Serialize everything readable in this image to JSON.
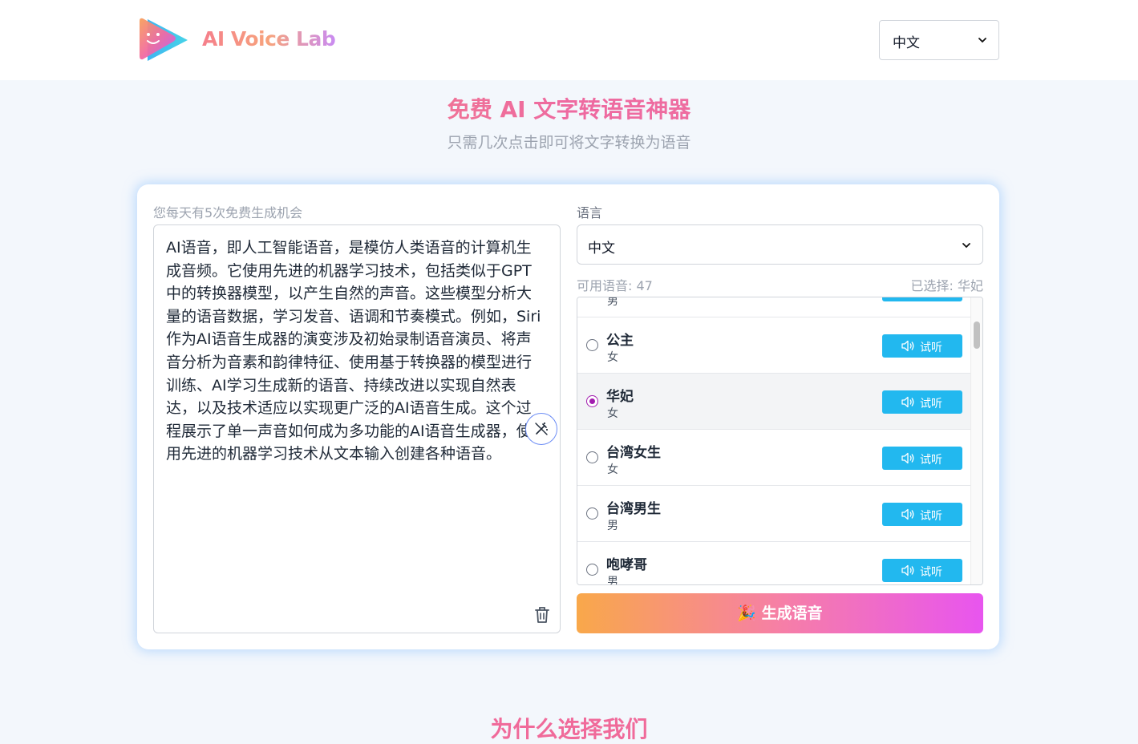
{
  "header": {
    "brand": "AI Voice Lab",
    "language_selected": "中文"
  },
  "hero": {
    "title": "免费 AI 文字转语音神器",
    "subtitle": "只需几次点击即可将文字转换为语音"
  },
  "editor": {
    "free_notice": "您每天有5次免费生成机会",
    "text": "AI语音，即人工智能语音，是模仿人类语音的计算机生成音频。它使用先进的机器学习技术，包括类似于GPT中的转换器模型，以产生自然的声音。这些模型分析大量的语音数据，学习发音、语调和节奏模式。例如，Siri作为AI语音生成器的演变涉及初始录制语音演员、将声音分析为音素和韵律特征、使用基于转换器的模型进行训练、AI学习生成新的语音、持续改进以实现自然表达，以及技术适应以实现更广泛的AI语音生成。这个过程展示了单一声音如何成为多功能的AI语音生成器，使用先进的机器学习技术从文本输入创建各种语音。",
    "icons": [
      "magic-wand-icon",
      "trash-icon"
    ]
  },
  "voice_panel": {
    "language_label": "语言",
    "language_selected": "中文",
    "available_label": "可用语音: 47",
    "selected_label": "已选择: 华妃",
    "play_label": "试听",
    "voices": [
      {
        "name": "",
        "gender": "男",
        "selected": false
      },
      {
        "name": "公主",
        "gender": "女",
        "selected": false
      },
      {
        "name": "华妃",
        "gender": "女",
        "selected": true
      },
      {
        "name": "台湾女生",
        "gender": "女",
        "selected": false
      },
      {
        "name": "台湾男生",
        "gender": "男",
        "selected": false
      },
      {
        "name": "咆哮哥",
        "gender": "男",
        "selected": false
      }
    ]
  },
  "generate": {
    "label": "🎉 生成语音"
  },
  "section": {
    "title": "为什么选择我们"
  },
  "colors": {
    "accent_blue": "#22b8ef",
    "radio_selected": "#a21caf",
    "gradient_start": "#f9a84a",
    "gradient_end": "#e855ef"
  }
}
